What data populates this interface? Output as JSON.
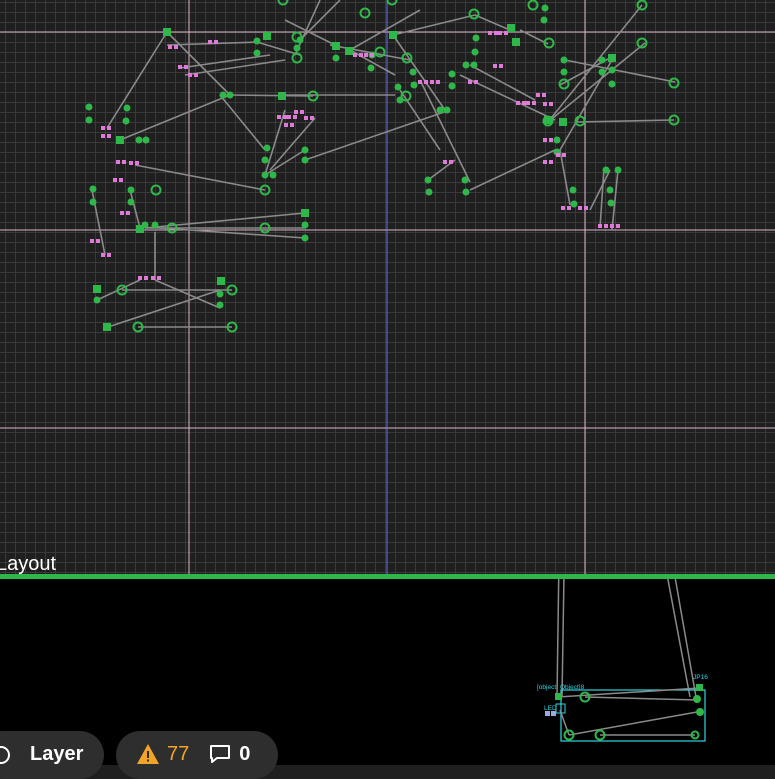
{
  "panes": {
    "layout_title": "Layout"
  },
  "layout_labels": {
    "object_a": "[object",
    "object_b": "Object]8",
    "net_d": "LED",
    "net_j": "JP16"
  },
  "status_bar": {
    "layer_label": "Layer",
    "warning_count": "77",
    "comment_count": "0"
  },
  "colors": {
    "grid_bg": "#1f1f1f",
    "grid_line": "#3a3a3a",
    "guide_pink": "#d9b7c8",
    "guide_blue": "#6b6fd8",
    "wire": "#8a8a8a",
    "pin_green": "#2fb84a",
    "pin_pink": "#e07ad8",
    "divider_green": "#2fb84a",
    "board_outline": "#2fd6e0",
    "warning": "#f2a428"
  },
  "icons": {
    "layer_toggle": "layer-ring-icon",
    "warning": "warning-triangle-icon",
    "comment": "comment-bubble-icon"
  }
}
